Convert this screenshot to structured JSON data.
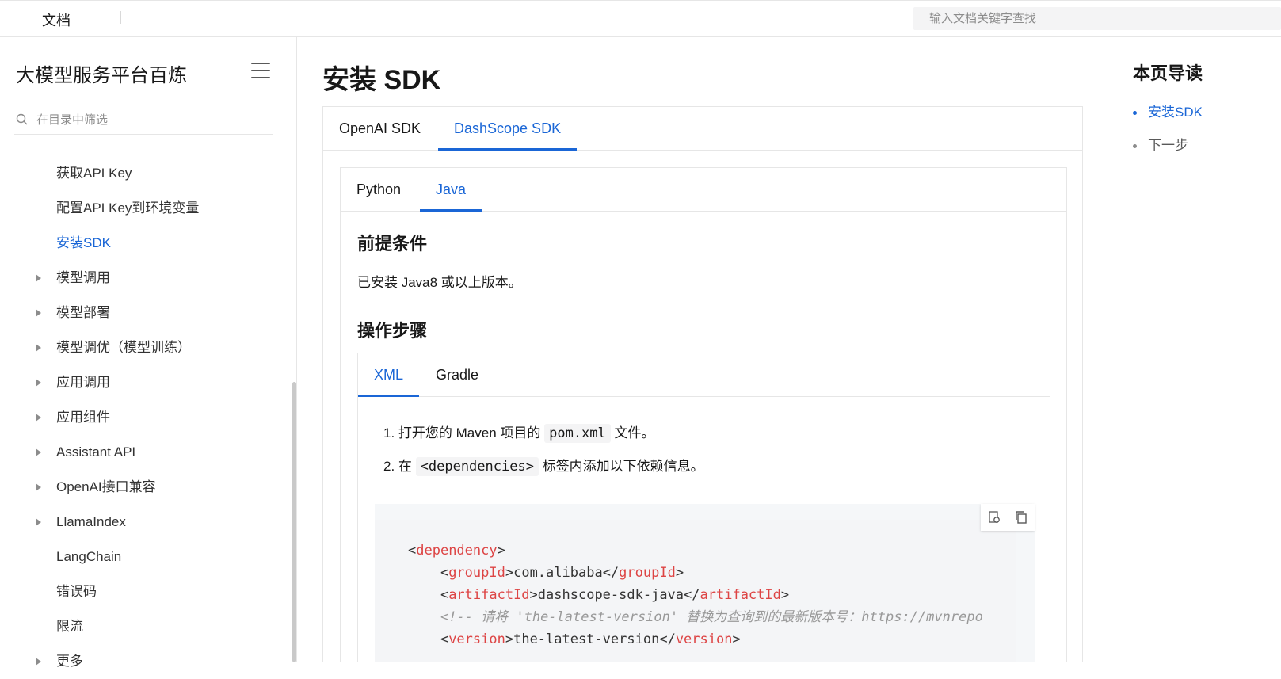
{
  "topbar": {
    "brand": "文档",
    "search_placeholder": "输入文档关键字查找"
  },
  "sidebar": {
    "title": "大模型服务平台百炼",
    "filter_placeholder": "在目录中筛选",
    "items": [
      {
        "label": "获取API Key",
        "expandable": false,
        "active": false
      },
      {
        "label": "配置API Key到环境变量",
        "expandable": false,
        "active": false
      },
      {
        "label": "安装SDK",
        "expandable": false,
        "active": true
      },
      {
        "label": "模型调用",
        "expandable": true,
        "active": false
      },
      {
        "label": "模型部署",
        "expandable": true,
        "active": false
      },
      {
        "label": "模型调优（模型训练）",
        "expandable": true,
        "active": false
      },
      {
        "label": "应用调用",
        "expandable": true,
        "active": false
      },
      {
        "label": "应用组件",
        "expandable": true,
        "active": false
      },
      {
        "label": "Assistant API",
        "expandable": true,
        "active": false
      },
      {
        "label": "OpenAI接口兼容",
        "expandable": true,
        "active": false
      },
      {
        "label": "LlamaIndex",
        "expandable": true,
        "active": false
      },
      {
        "label": "LangChain",
        "expandable": false,
        "active": false
      },
      {
        "label": "错误码",
        "expandable": false,
        "active": false
      },
      {
        "label": "限流",
        "expandable": false,
        "active": false
      },
      {
        "label": "更多",
        "expandable": true,
        "active": false
      }
    ]
  },
  "main": {
    "title": "安装 SDK",
    "sdk_tabs": [
      "OpenAI SDK",
      "DashScope SDK"
    ],
    "lang_tabs": [
      "Python",
      "Java"
    ],
    "prereq_heading": "前提条件",
    "prereq_text": "已安装 Java8 或以上版本。",
    "steps_heading": "操作步骤",
    "build_tabs": [
      "XML",
      "Gradle"
    ],
    "step1_prefix": "1. 打开您的 Maven 项目的",
    "step1_code": "pom.xml",
    "step1_suffix": "文件。",
    "step2_prefix": "2. 在",
    "step2_code": "<dependencies>",
    "step2_suffix": "标签内添加以下依赖信息。",
    "code": {
      "l1_open": "<",
      "l1_tag": "dependency",
      "l1_close": ">",
      "l2_tag_open": "groupId",
      "l2_value": "com.alibaba",
      "l2_tag_close": "groupId",
      "l3_tag_open": "artifactId",
      "l3_value": "dashscope-sdk-java",
      "l3_tag_close": "artifactId",
      "l4_comment": "<!-- 请将 'the-latest-version' 替换为查询到的最新版本号：https://mvnrepo",
      "l5_tag_open": "version",
      "l5_value": "the-latest-version",
      "l5_tag_close": "version"
    }
  },
  "toc": {
    "title": "本页导读",
    "items": [
      "安装SDK",
      "下一步"
    ]
  },
  "colors": {
    "accent": "#1a66d6",
    "tag": "#dd4444",
    "comment": "#999999"
  }
}
